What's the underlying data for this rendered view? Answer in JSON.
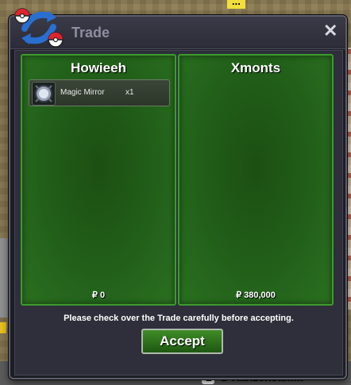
{
  "window": {
    "title": "Trade",
    "close_label": "✕"
  },
  "trade": {
    "left": {
      "player": "Howieeh",
      "money": "₽ 0",
      "items": [
        {
          "name": "Magic Mirror",
          "qty": "x1",
          "icon": "magic-mirror-icon"
        }
      ]
    },
    "right": {
      "player": "Xmonts",
      "money": "₽ 380,000",
      "items": []
    },
    "notice": "Please check over the Trade carefully before accepting.",
    "accept_label": "Accept"
  },
  "world": {
    "top_name_fragment": "...",
    "bottom_name": "Kanzensamm"
  },
  "colors": {
    "panel_green": "#22601a",
    "panel_border": "#3e9a2e",
    "window_bg": "#1d1d25",
    "accept_green": "#3e8c26"
  }
}
